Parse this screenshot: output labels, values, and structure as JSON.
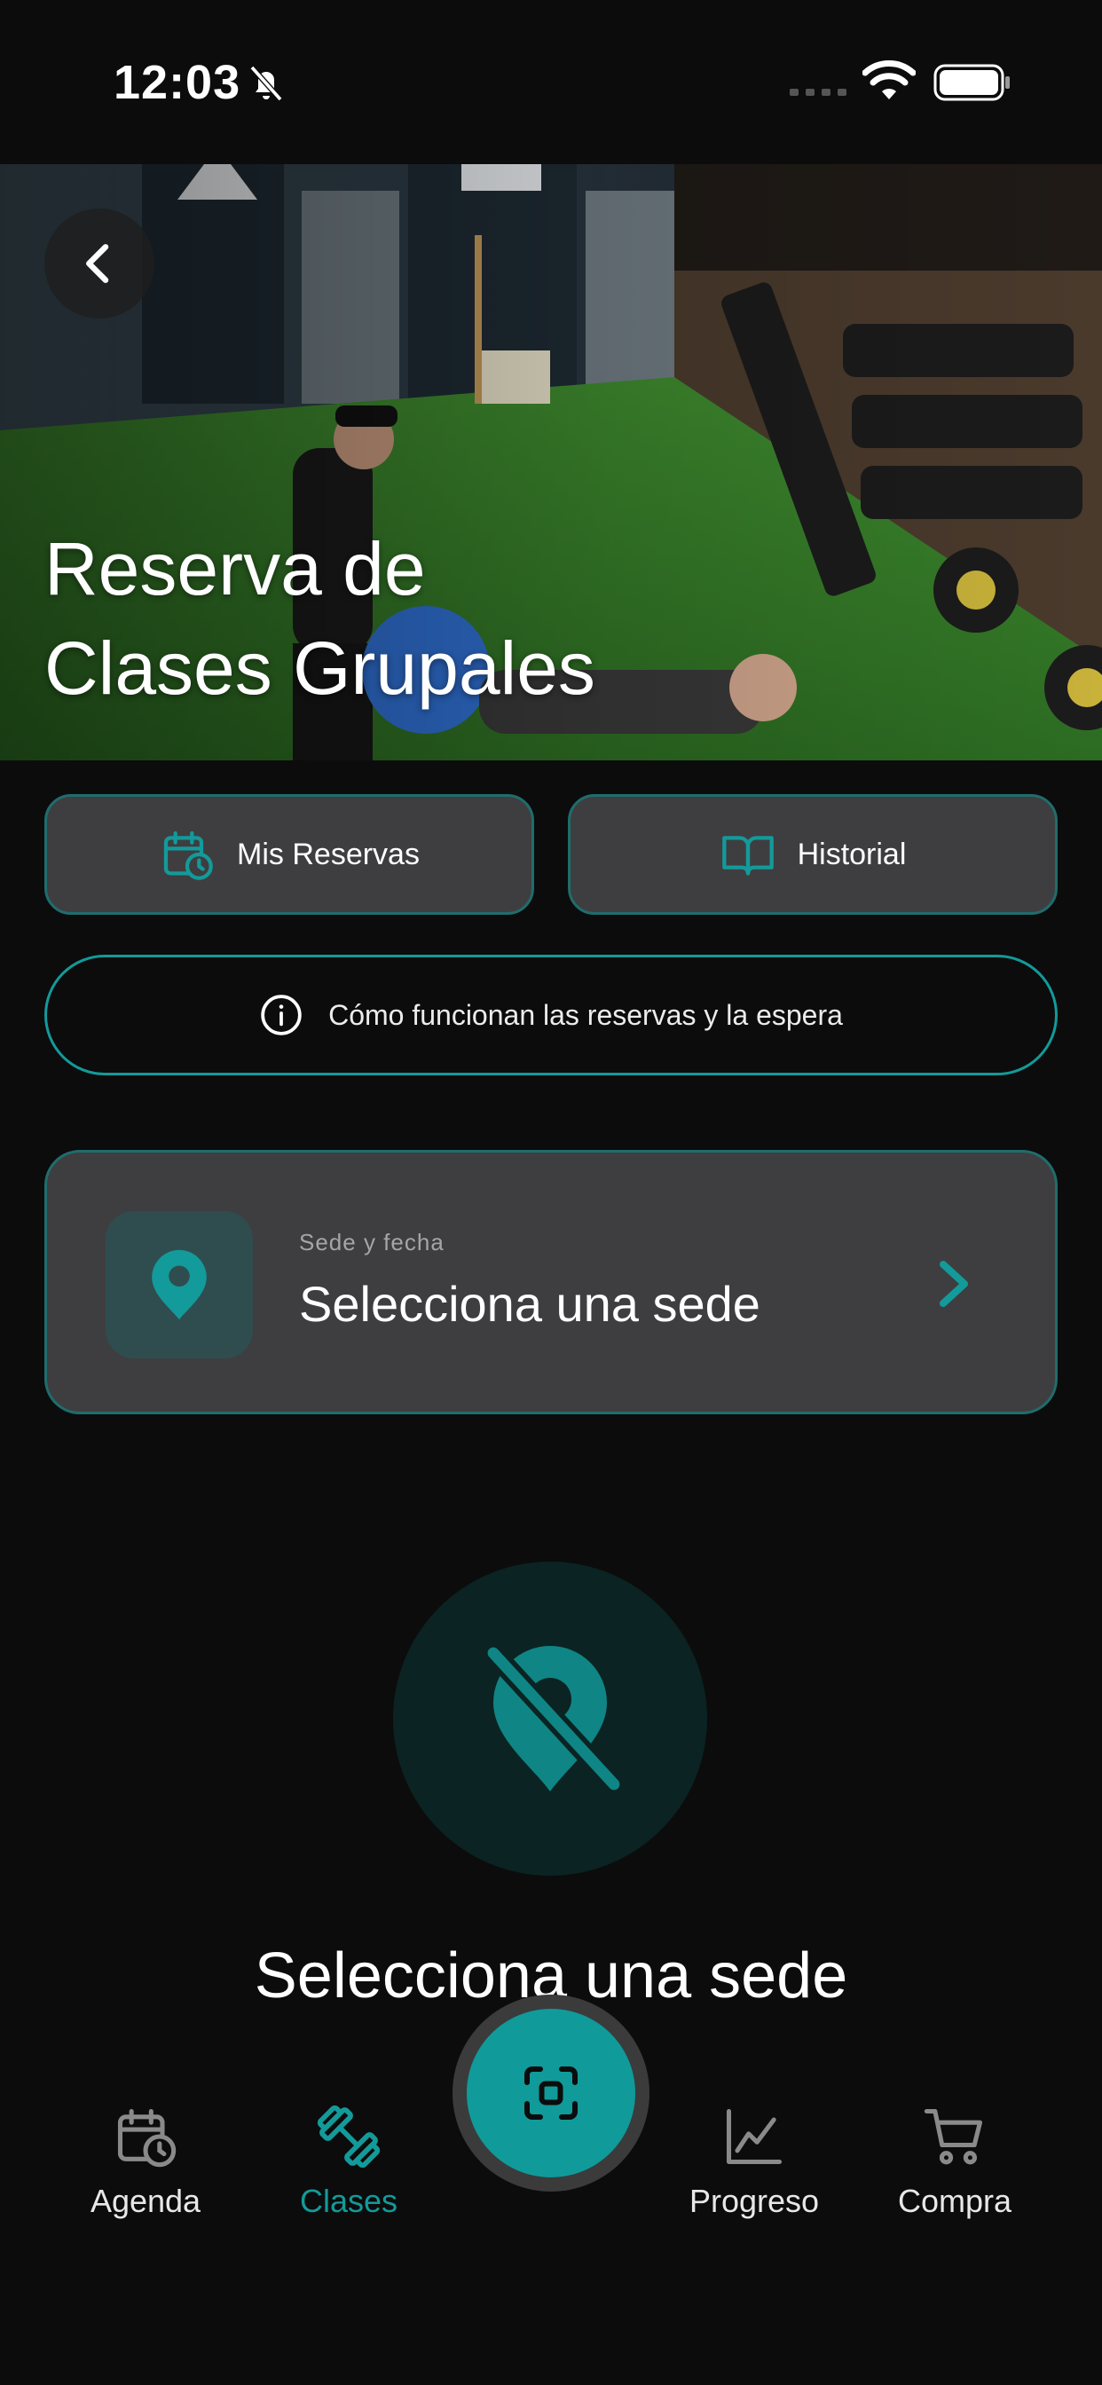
{
  "status_bar": {
    "time": "12:03"
  },
  "hero": {
    "title_line1": "Reserva de",
    "title_line2": "Clases Grupales"
  },
  "actions": {
    "mis_reservas_label": "Mis Reservas",
    "historial_label": "Historial"
  },
  "info": {
    "label": "Cómo funcionan las reservas y la espera"
  },
  "sede_card": {
    "caption": "Sede y fecha",
    "value": "Selecciona una sede"
  },
  "empty_state": {
    "title": "Selecciona una sede"
  },
  "bottom_nav": {
    "items": [
      {
        "label": "Agenda",
        "icon": "calendar-clock-icon",
        "active": false
      },
      {
        "label": "Clases",
        "icon": "dumbbell-icon",
        "active": true
      },
      {
        "label": "Progreso",
        "icon": "chart-line-icon",
        "active": false
      },
      {
        "label": "Compra",
        "icon": "cart-icon",
        "active": false
      }
    ],
    "center_icon": "scan-icon"
  },
  "colors": {
    "accent": "#139a9a",
    "background": "#0c0c0c",
    "card": "#3e3e40"
  }
}
